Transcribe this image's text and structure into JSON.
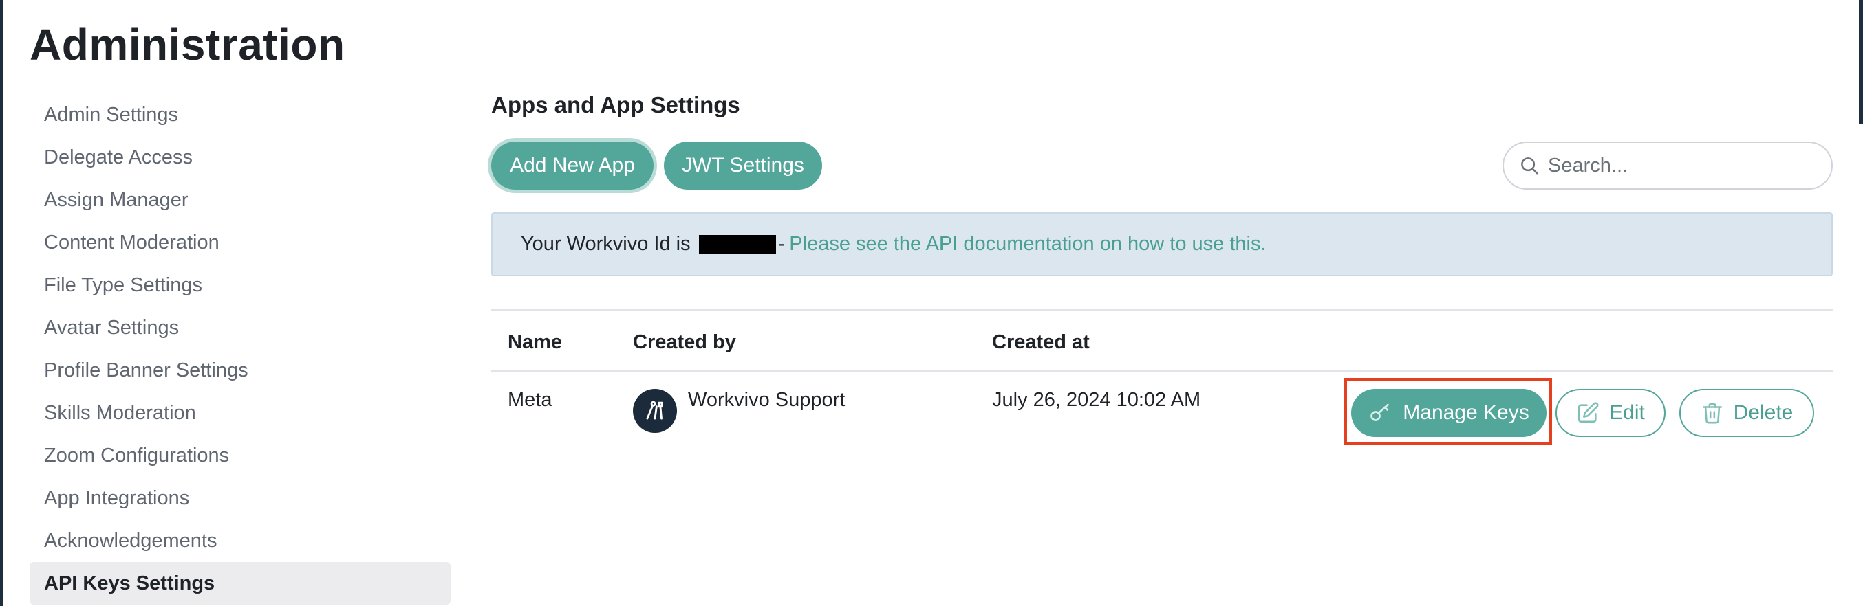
{
  "page": {
    "title": "Administration"
  },
  "sidebar": {
    "items": [
      {
        "label": "Admin Settings"
      },
      {
        "label": "Delegate Access"
      },
      {
        "label": "Assign Manager"
      },
      {
        "label": "Content Moderation"
      },
      {
        "label": "File Type Settings"
      },
      {
        "label": "Avatar Settings"
      },
      {
        "label": "Profile Banner Settings"
      },
      {
        "label": "Skills Moderation"
      },
      {
        "label": "Zoom Configurations"
      },
      {
        "label": "App Integrations"
      },
      {
        "label": "Acknowledgements"
      },
      {
        "label": "API Keys Settings",
        "active": true
      }
    ]
  },
  "main": {
    "section_title": "Apps and App Settings",
    "add_button": "Add New App",
    "jwt_button": "JWT Settings",
    "search": {
      "placeholder": "Search...",
      "value": "",
      "icon": "search-icon"
    },
    "banner": {
      "prefix": "Your Workvivo Id is",
      "separator": "-",
      "link_text": "Please see the API documentation on how to use this."
    },
    "table": {
      "columns": [
        "Name",
        "Created by",
        "Created at"
      ],
      "rows": [
        {
          "name": "Meta",
          "created_by": "Workvivo Support",
          "created_at": "July 26, 2024 10:02 AM",
          "actions": {
            "manage_keys": "Manage Keys",
            "edit": "Edit",
            "delete": "Delete"
          }
        }
      ]
    }
  },
  "colors": {
    "accent": "#52a69a",
    "accent_text": "#4a9f93",
    "banner_bg": "#dbe6ef",
    "highlight": "#e2401f",
    "sidebar_active_bg": "#ececef"
  }
}
